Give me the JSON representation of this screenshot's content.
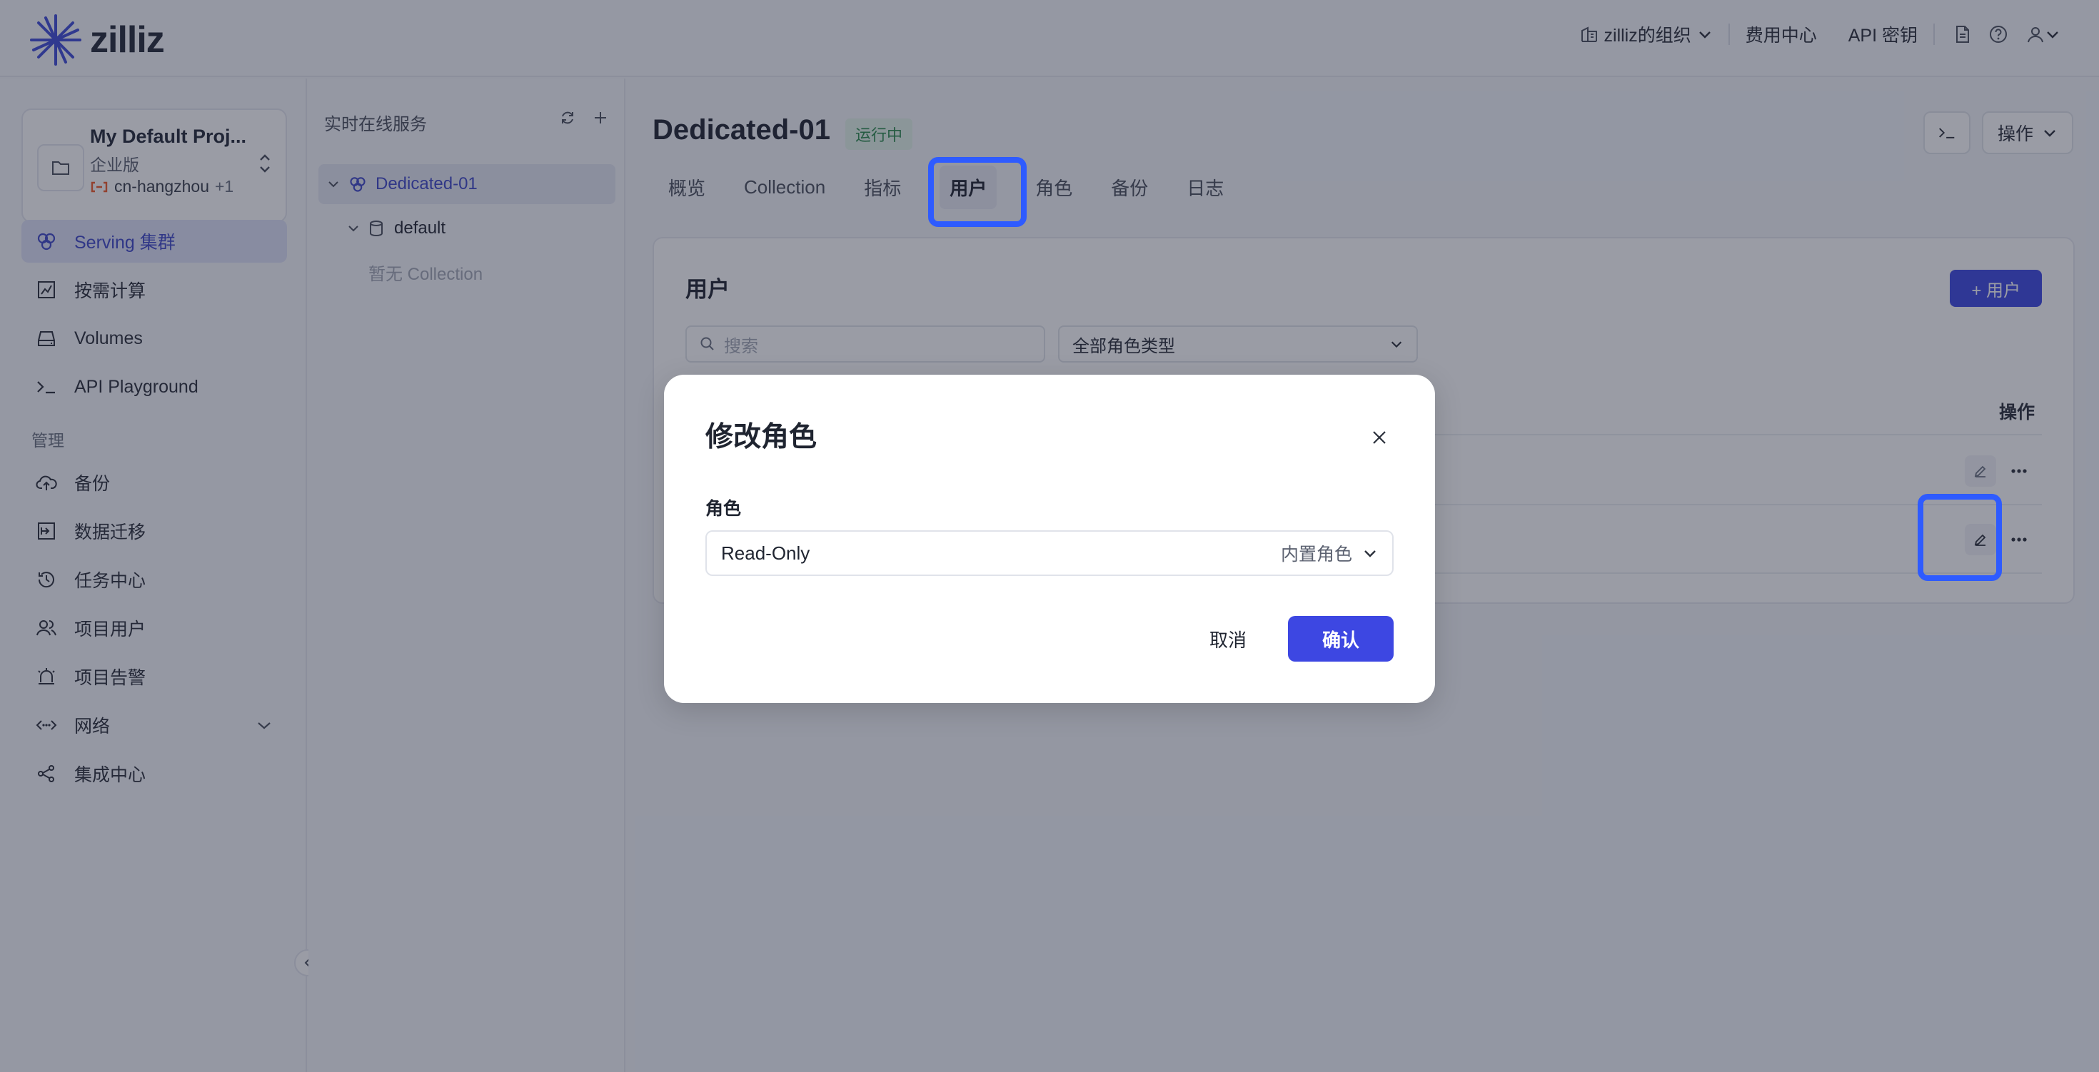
{
  "app": {
    "brand": "zilliz"
  },
  "topbar": {
    "org": "zilliz的组织",
    "billing": "费用中心",
    "api_key": "API 密钥"
  },
  "project": {
    "name": "My Default Proj...",
    "tier": "企业版",
    "region": "cn-hangzhou",
    "region_extra": "+1"
  },
  "sidebar": {
    "items": [
      {
        "label": "Serving 集群",
        "icon": "cluster-icon",
        "active": true
      },
      {
        "label": "按需计算",
        "icon": "chart-icon"
      },
      {
        "label": "Volumes",
        "icon": "drive-icon"
      },
      {
        "label": "API Playground",
        "icon": "terminal-icon"
      }
    ],
    "section_title": "管理",
    "manage_items": [
      {
        "label": "备份",
        "icon": "cloud-upload-icon"
      },
      {
        "label": "数据迁移",
        "icon": "migrate-icon"
      },
      {
        "label": "任务中心",
        "icon": "history-icon"
      },
      {
        "label": "项目用户",
        "icon": "users-icon"
      },
      {
        "label": "项目告警",
        "icon": "alarm-icon"
      },
      {
        "label": "网络",
        "icon": "network-icon"
      },
      {
        "label": "集成中心",
        "icon": "share-icon"
      }
    ]
  },
  "tree": {
    "title": "实时在线服务",
    "cluster": "Dedicated-01",
    "database": "default",
    "empty": "暂无 Collection"
  },
  "cluster": {
    "title": "Dedicated-01",
    "status": "运行中",
    "status_color": "#2c8a4d",
    "actions_label": "操作",
    "tabs": [
      "概览",
      "Collection",
      "指标",
      "用户",
      "角色",
      "备份",
      "日志"
    ],
    "active_tab": "用户"
  },
  "users_panel": {
    "title": "用户",
    "add_button": "+ 用户",
    "search_placeholder": "搜索",
    "role_filter": "全部角色类型",
    "actions_header": "操作"
  },
  "modal": {
    "title": "修改角色",
    "field_label": "角色",
    "selected_role": "Read-Only",
    "role_type": "内置角色",
    "cancel": "取消",
    "confirm": "确认"
  },
  "colors": {
    "accent": "#3d47e2",
    "highlight": "#2e5bff"
  }
}
